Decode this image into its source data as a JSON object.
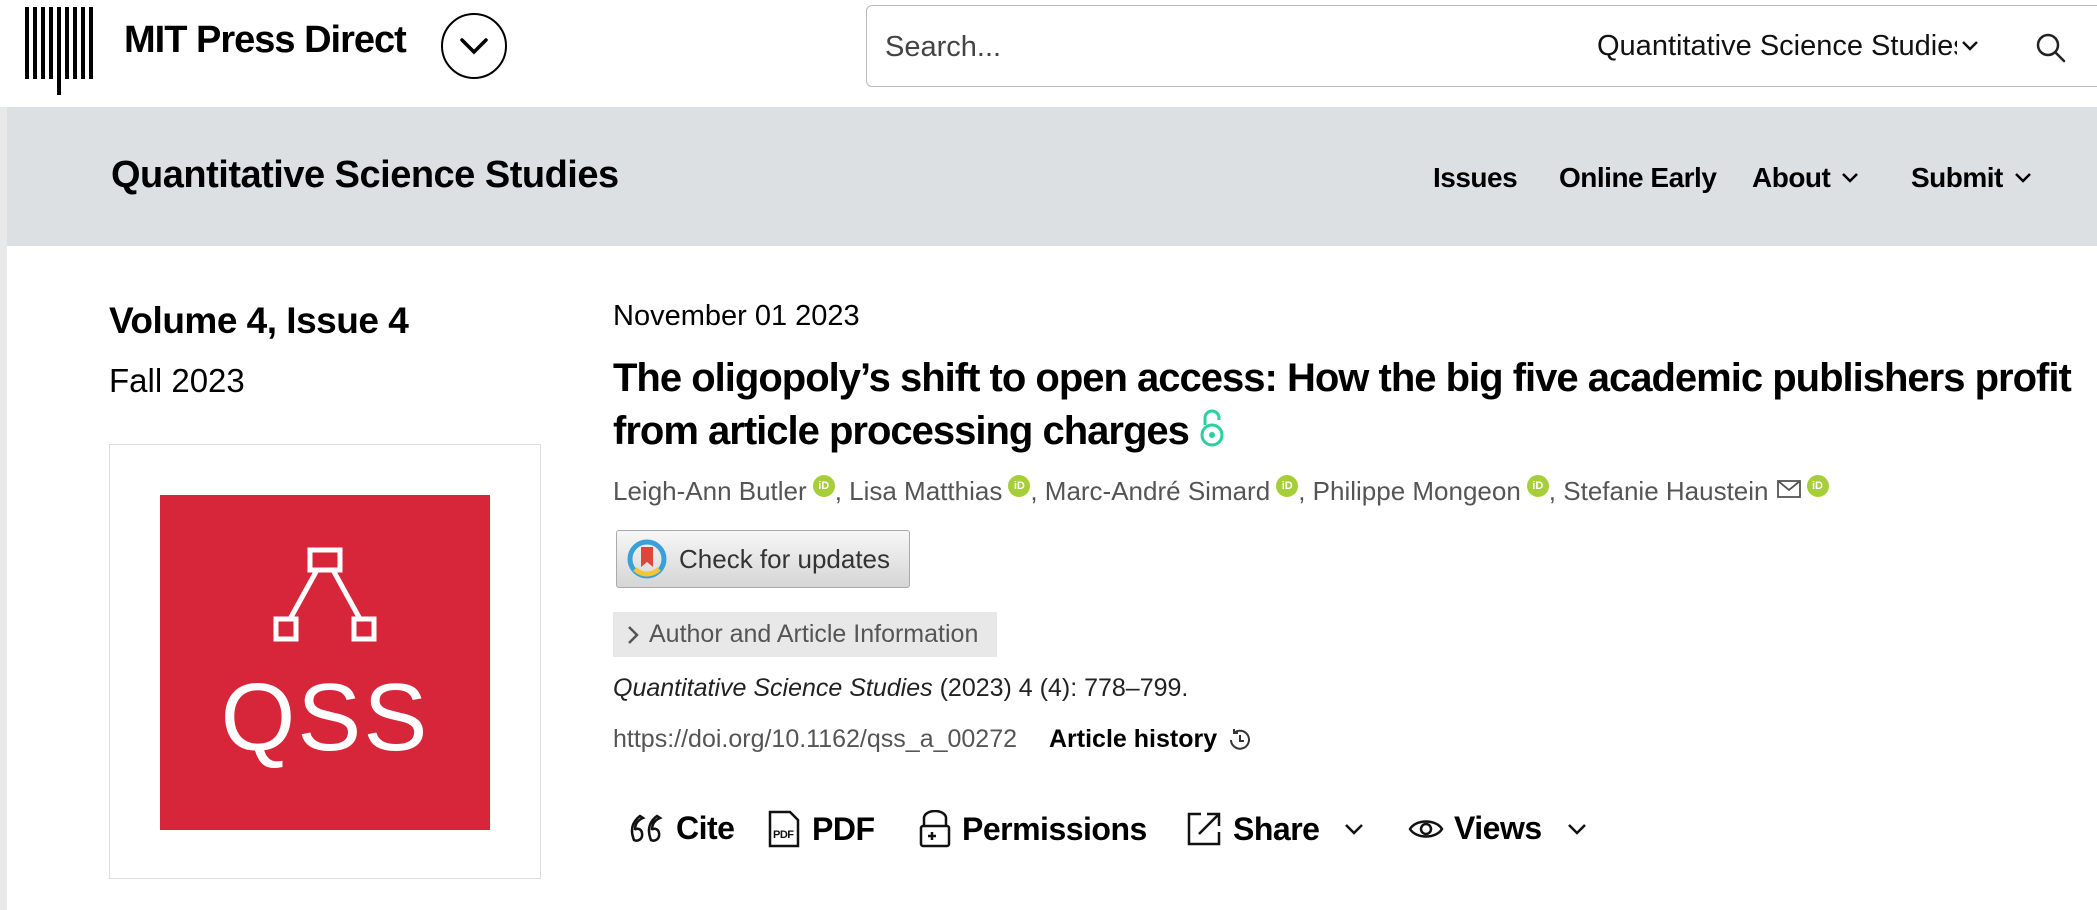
{
  "header": {
    "brand": "MIT Press Direct",
    "search_placeholder": "Search...",
    "search_scope": "Quantitative Science Studies"
  },
  "journal": {
    "title": "Quantitative Science Studies",
    "nav": [
      "Issues",
      "Online Early",
      "About",
      "Submit"
    ]
  },
  "issue": {
    "heading": "Volume 4, Issue 4",
    "season": "Fall 2023",
    "cover_text": "QSS",
    "cover_color": "#d7253a"
  },
  "article": {
    "date": "November 01 2023",
    "title": "The oligopoly’s shift to open access: How the big five academic publishers profit from article processing charges",
    "authors": [
      "Leigh-Ann Butler",
      "Lisa Matthias",
      "Marc-André Simard",
      "Philippe Mongeon",
      "Stefanie Haustein"
    ],
    "check_updates": "Check for updates",
    "author_info": "Author and Article Information",
    "citation_journal": "Quantitative Science Studies",
    "citation_rest": " (2023) 4 (4): 778–799.",
    "doi": "https://doi.org/10.1162/qss_a_00272",
    "history": "Article history"
  },
  "tools": {
    "cite": "Cite",
    "pdf": "PDF",
    "permissions": "Permissions",
    "share": "Share",
    "views": "Views"
  },
  "colors": {
    "orcid": "#a6ce39",
    "open_access": "#2ad0a0",
    "journal_bar": "#dde0e3"
  }
}
